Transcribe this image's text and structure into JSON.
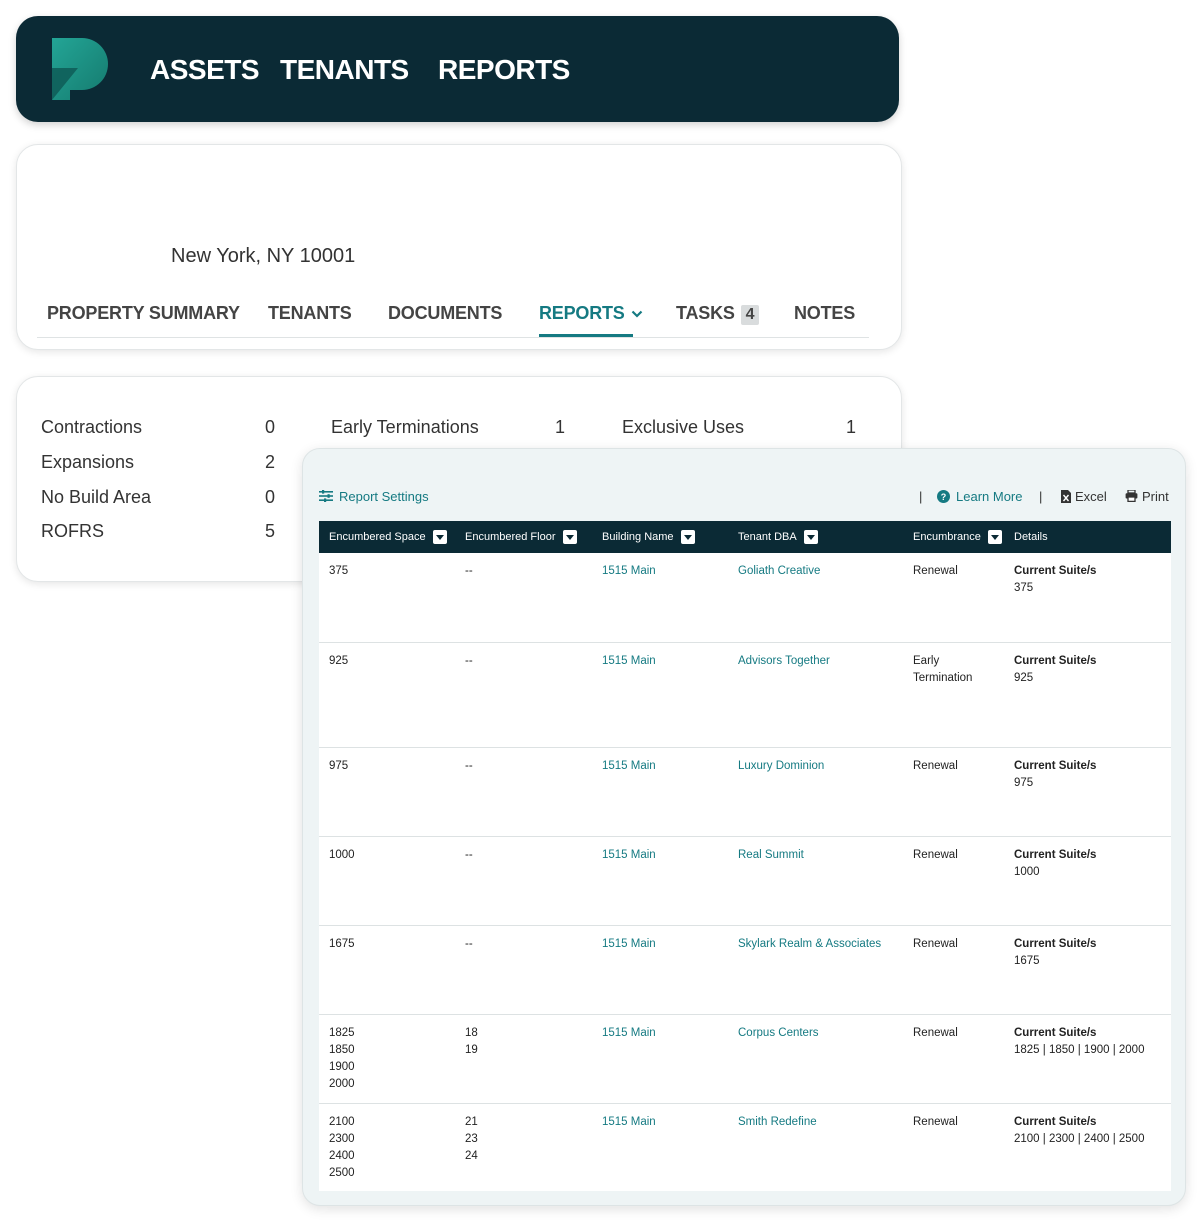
{
  "nav": {
    "items": [
      "ASSETS",
      "TENANTS",
      "REPORTS"
    ],
    "colors": {
      "bg": "#0b2a35",
      "accent": "#157a82"
    }
  },
  "property": {
    "address": "New York, NY 10001",
    "tabs": [
      {
        "label": "PROPERTY SUMMARY"
      },
      {
        "label": "TENANTS"
      },
      {
        "label": "DOCUMENTS"
      },
      {
        "label": "REPORTS",
        "active": true
      },
      {
        "label": "TASKS",
        "badge": "4"
      },
      {
        "label": "NOTES"
      }
    ]
  },
  "counts": [
    {
      "label": "Contractions",
      "value": "0"
    },
    {
      "label": "Expansions",
      "value": "2"
    },
    {
      "label": "No Build Area",
      "value": "0"
    },
    {
      "label": "ROFRS",
      "value": "5"
    },
    {
      "label": "Early Terminations",
      "value": "1"
    },
    {
      "label": "Exclusive Uses",
      "value": "1"
    }
  ],
  "report": {
    "settings_label": "Report Settings",
    "learn_more_label": "Learn More",
    "excel_label": "Excel",
    "print_label": "Print",
    "separator": "|",
    "columns": [
      "Encumbered Space",
      "Encumbered Floor",
      "Building Name",
      "Tenant DBA",
      "Encumbrance",
      "Details"
    ],
    "rows": [
      {
        "space": [
          "375"
        ],
        "floor": [
          "--"
        ],
        "building": "1515 Main",
        "tenant": "Goliath Creative",
        "encumbrance": [
          "Renewal"
        ],
        "details_label": "Current Suite/s",
        "details_value": "375"
      },
      {
        "space": [
          "925"
        ],
        "floor": [
          "--"
        ],
        "building": "1515 Main",
        "tenant": "Advisors Together",
        "encumbrance": [
          "Early",
          "Termination"
        ],
        "details_label": "Current Suite/s",
        "details_value": "925"
      },
      {
        "space": [
          "975"
        ],
        "floor": [
          "--"
        ],
        "building": "1515 Main",
        "tenant": "Luxury Dominion",
        "encumbrance": [
          "Renewal"
        ],
        "details_label": "Current Suite/s",
        "details_value": "975"
      },
      {
        "space": [
          "1000"
        ],
        "floor": [
          "--"
        ],
        "building": "1515 Main",
        "tenant": "Real Summit",
        "encumbrance": [
          "Renewal"
        ],
        "details_label": "Current Suite/s",
        "details_value": "1000"
      },
      {
        "space": [
          "1675"
        ],
        "floor": [
          "--"
        ],
        "building": "1515 Main",
        "tenant": "Skylark Realm & Associates",
        "encumbrance": [
          "Renewal"
        ],
        "details_label": "Current Suite/s",
        "details_value": "1675"
      },
      {
        "space": [
          "1825",
          "1850",
          "1900",
          "2000"
        ],
        "floor": [
          "18",
          "19"
        ],
        "building": "1515 Main",
        "tenant": "Corpus Centers",
        "encumbrance": [
          "Renewal"
        ],
        "details_label": "Current Suite/s",
        "details_value": "1825 | 1850 | 1900 | 2000"
      },
      {
        "space": [
          "2100",
          "2300",
          "2400",
          "2500"
        ],
        "floor": [
          "21",
          "23",
          "24"
        ],
        "building": "1515 Main",
        "tenant": "Smith Redefine",
        "encumbrance": [
          "Renewal"
        ],
        "details_label": "Current Suite/s",
        "details_value": "2100 | 2300 | 2400 | 2500"
      }
    ]
  }
}
